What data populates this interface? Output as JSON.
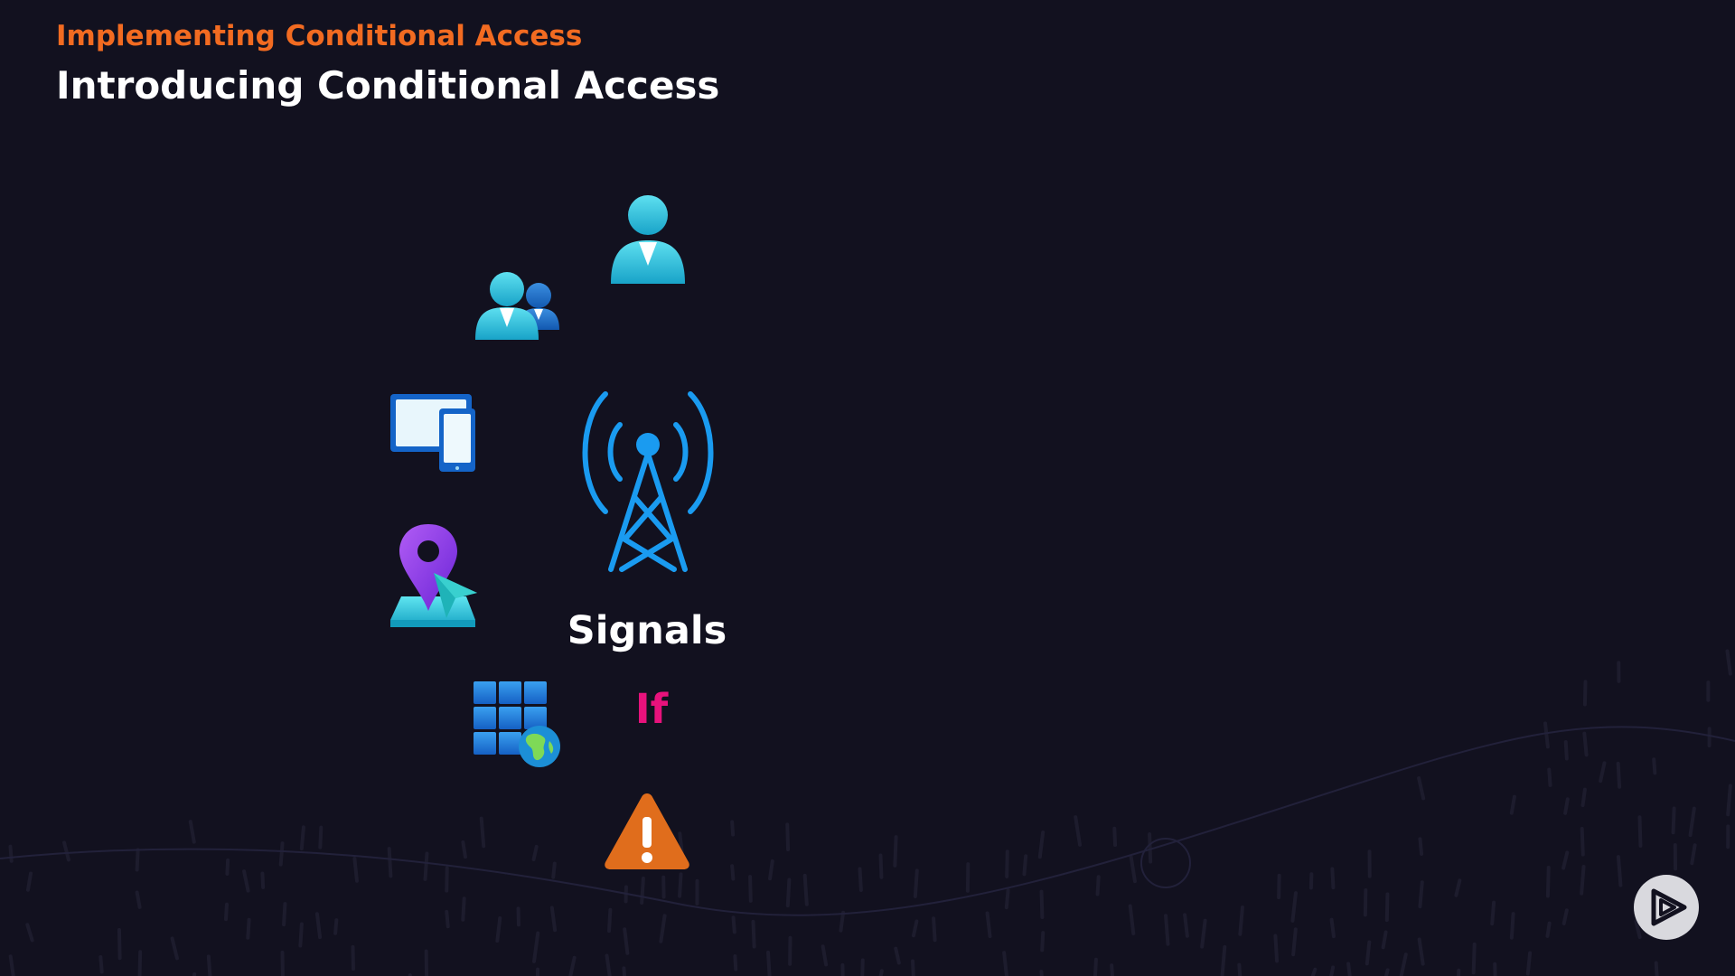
{
  "slide": {
    "module_title": "Implementing Conditional Access",
    "title": "Introducing Conditional Access",
    "signals_label": "Signals",
    "if_label": "If"
  },
  "icons": {
    "user": "user-icon",
    "group": "group-icon",
    "devices": "devices-icon",
    "location": "location-icon",
    "application": "application-icon",
    "signal_tower": "signal-tower-icon",
    "risk": "warning-icon",
    "player": "play-logo-icon"
  },
  "colors": {
    "module_title": "#f26b21",
    "title": "#ffffff",
    "if": "#e8127c",
    "tower": "#1a9bf0",
    "background": "#12111f"
  }
}
